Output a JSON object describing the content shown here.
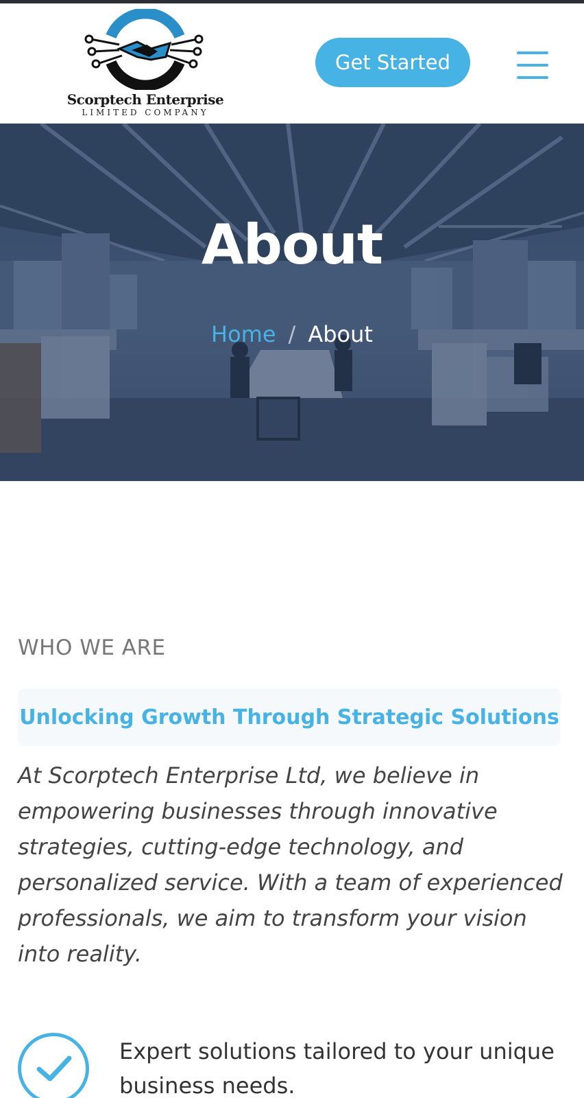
{
  "header": {
    "logo": {
      "name": "Scorptech Enterprise",
      "subtitle": "LIMITED COMPANY"
    },
    "cta_label": "Get Started",
    "menu_icon": "hamburger-menu-icon"
  },
  "hero": {
    "title": "About",
    "breadcrumb": {
      "home": "Home",
      "separator": "/",
      "current": "About"
    }
  },
  "about": {
    "eyebrow": "WHO WE ARE",
    "heading": "Unlocking Growth Through Strategic Solutions",
    "intro": "At Scorptech Enterprise Ltd, we believe in empowering businesses through innovative strategies, cutting-edge technology, and personalized service. With a team of experienced professionals, we aim to transform your vision into reality.",
    "features": [
      {
        "icon": "check-circle-icon",
        "text": "Expert solutions tailored to your unique business needs."
      }
    ]
  },
  "colors": {
    "accent": "#47b2e4",
    "hero_overlay": "#3f5572",
    "heading_box": "#f5f9fc"
  }
}
